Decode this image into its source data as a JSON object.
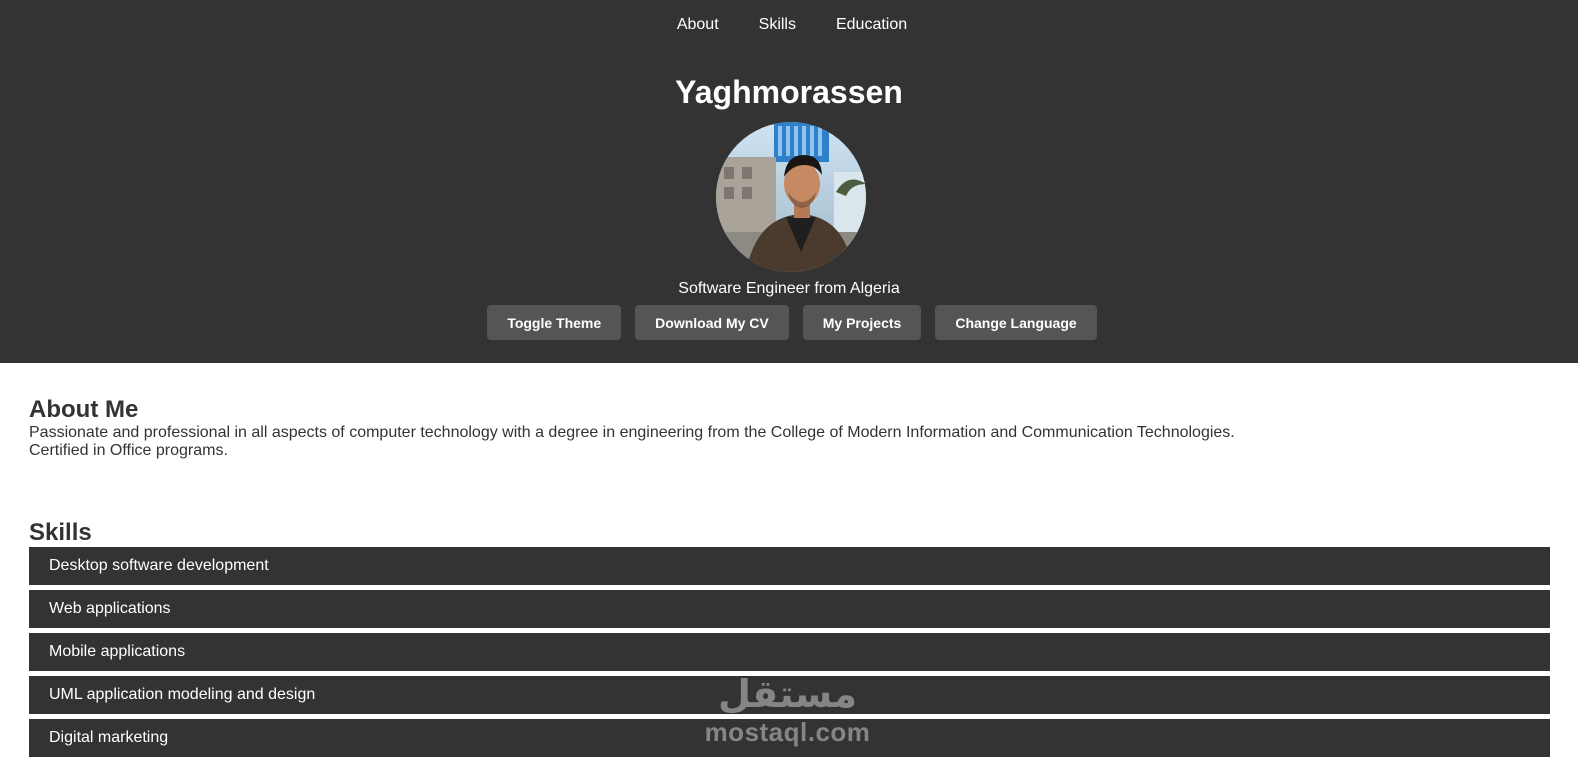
{
  "nav": {
    "items": [
      {
        "label": "About"
      },
      {
        "label": "Skills"
      },
      {
        "label": "Education"
      }
    ]
  },
  "header": {
    "title": "Yaghmorassen",
    "tagline": "Software Engineer from Algeria",
    "background": "#333333"
  },
  "actions": {
    "toggle_theme": "Toggle Theme",
    "download_cv": "Download My CV",
    "my_projects": "My Projects",
    "change_language": "Change Language",
    "button_color": "#555555"
  },
  "about": {
    "title": "About Me",
    "line1": "Passionate and professional in all aspects of computer technology with a degree in engineering from the College of Modern Information and Communication Technologies.",
    "line2": "Certified in Office programs."
  },
  "skills": {
    "title": "Skills",
    "items": [
      {
        "label": "Desktop software development"
      },
      {
        "label": "Web applications"
      },
      {
        "label": "Mobile applications"
      },
      {
        "label": "UML application modeling and design"
      },
      {
        "label": "Digital marketing"
      }
    ]
  },
  "watermark": {
    "arabic": "مستقل",
    "latin": "mostaql.com"
  }
}
